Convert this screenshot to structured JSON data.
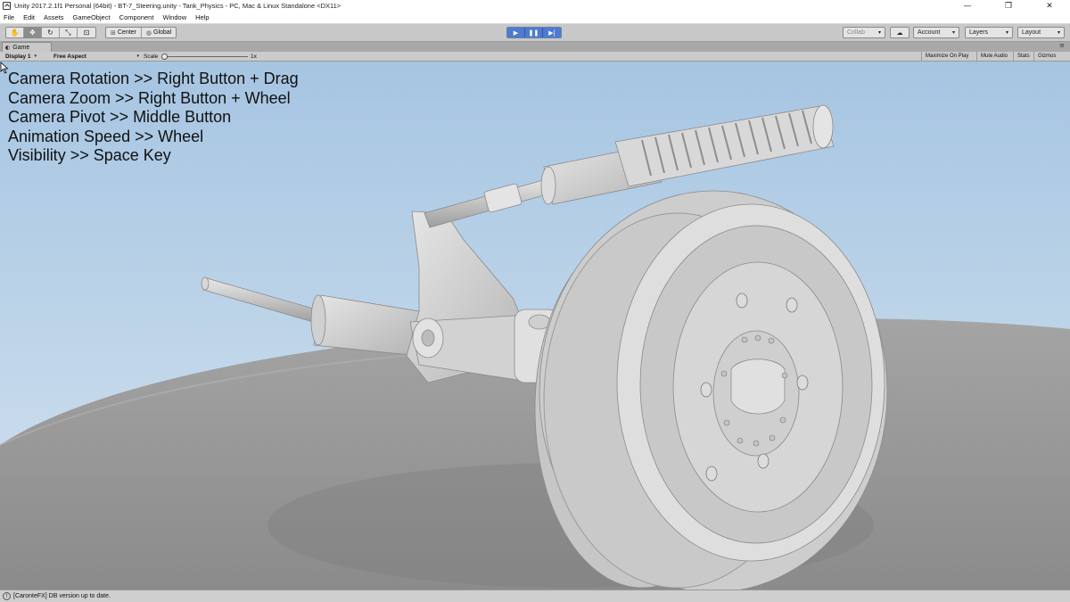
{
  "window": {
    "title": "Unity 2017.2.1f1 Personal (64bit) - BT-7_Steering.unity - Tank_Physics - PC, Mac & Linux Standalone <DX11>",
    "controls": [
      "—",
      "❐",
      "✕"
    ]
  },
  "menu": [
    "File",
    "Edit",
    "Assets",
    "GameObject",
    "Component",
    "Window",
    "Help"
  ],
  "toolbar": {
    "tools": [
      {
        "icon": "hand-icon",
        "glyph": "✋"
      },
      {
        "icon": "move-icon",
        "glyph": "✥"
      },
      {
        "icon": "rotate-icon",
        "glyph": "↻"
      },
      {
        "icon": "scale-icon",
        "glyph": "⤡"
      },
      {
        "icon": "rect-icon",
        "glyph": "⊡"
      }
    ],
    "pivot": "Center",
    "space": "Global",
    "play": [
      {
        "icon": "play-icon",
        "glyph": "▶"
      },
      {
        "icon": "pause-icon",
        "glyph": "❚❚"
      },
      {
        "icon": "step-icon",
        "glyph": "▶|"
      }
    ],
    "collab": "Collab",
    "account": "Account",
    "layers": "Layers",
    "layout": "Layout"
  },
  "game_tab": {
    "label": "Game"
  },
  "game_bar": {
    "display": "Display 1",
    "aspect": "Free Aspect",
    "scale_label": "Scale",
    "scale_value": "1x",
    "maximize": "Maximize On Play",
    "mute": "Mute Audio",
    "stats": "Stats",
    "gizmos": "Gizmos"
  },
  "overlay_lines": [
    "Camera Rotation >> Right Button + Drag",
    "Camera Zoom >> Right Button + Wheel",
    "Camera Pivot >> Middle Button",
    "Animation Speed >> Wheel",
    "Visibility >> Space Key"
  ],
  "status": {
    "text": "[CaronteFX] DB version up to date."
  },
  "colors": {
    "sky_top": "#a9c8e4",
    "ground": "#9a9a9a",
    "play_accent": "#4d7bd1"
  }
}
